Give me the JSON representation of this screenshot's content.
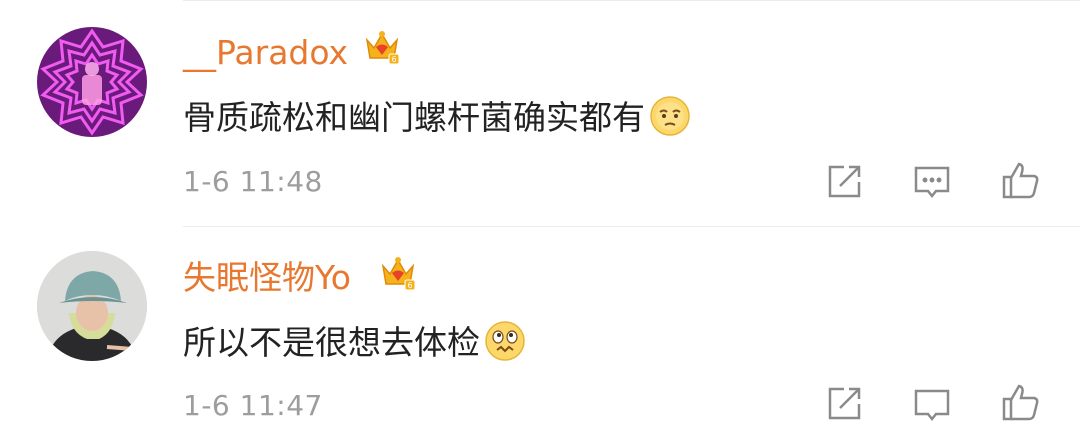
{
  "comments": [
    {
      "username": "__Paradox",
      "text": "骨质疏松和幽门螺杆菌确实都有",
      "emoji": "worried-face-emoji",
      "time": "1-6 11:48",
      "avatar": "purple-geometric-avatar"
    },
    {
      "username": "失眠怪物Yo",
      "text": "所以不是很想去体检",
      "emoji": "nervous-face-emoji",
      "time": "1-6 11:47",
      "avatar": "bucket-hat-person-avatar"
    }
  ],
  "actions": [
    "share-icon",
    "reply-icon",
    "like-icon"
  ],
  "colors": {
    "username": "#e8782f",
    "text": "#222222",
    "timestamp": "#9d9d9d",
    "icon": "#8a8a8a",
    "divider": "#ececec"
  }
}
